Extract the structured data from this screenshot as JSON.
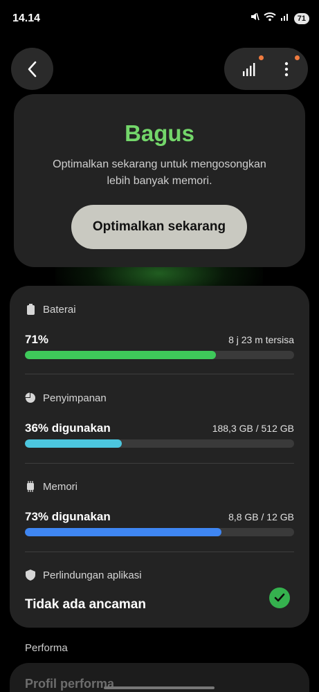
{
  "status_bar": {
    "time": "14.14",
    "battery_level": "71",
    "icons": [
      "mute-icon",
      "wifi-icon",
      "signal-icon",
      "battery-icon"
    ]
  },
  "header": {
    "back_icon": "chevron-left-icon",
    "actions": [
      {
        "icon": "bar-chart-icon",
        "has_badge": true
      },
      {
        "icon": "more-vertical-icon",
        "has_badge": true
      }
    ]
  },
  "status": {
    "title": "Bagus",
    "description": "Optimalkan sekarang untuk mengosongkan lebih banyak memori.",
    "button_label": "Optimalkan sekarang",
    "accent_color": "#73d66a"
  },
  "battery": {
    "label": "Baterai",
    "value": "71%",
    "detail": "8 j 23 m tersisa",
    "level": 0.71,
    "color": "#3ec95a"
  },
  "storage": {
    "label": "Penyimpanan",
    "value": "36% digunakan",
    "detail": "188,3 GB / 512 GB",
    "level": 0.36,
    "color": "#4cc6de"
  },
  "memory": {
    "label": "Memori",
    "value": "73% digunakan",
    "detail": "8,8 GB / 12 GB",
    "level": 0.73,
    "color": "#3f86f2"
  },
  "protection": {
    "label": "Perlindungan aplikasi",
    "value": "Tidak ada ancaman",
    "status_color": "#35b14e"
  },
  "performance": {
    "section_label": "Performa",
    "card_title": "Profil performa"
  }
}
